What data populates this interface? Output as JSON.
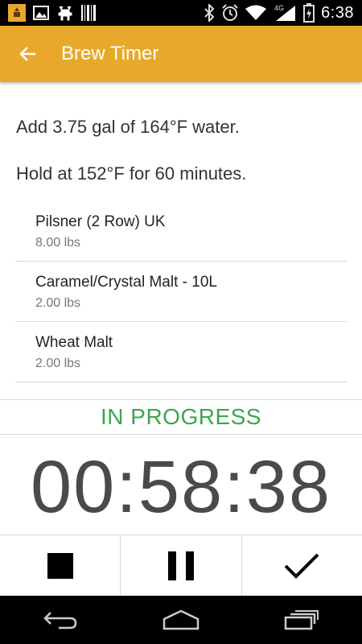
{
  "status_bar": {
    "time": "6:38",
    "network": "4G",
    "icons": [
      "brewery-icon",
      "image-icon",
      "deer-icon",
      "barcode-icon",
      "bluetooth-icon",
      "alarm-icon",
      "wifi-icon",
      "signal-icon",
      "battery-icon"
    ]
  },
  "app_bar": {
    "title": "Brew Timer",
    "background": "#e8a92a"
  },
  "instructions": {
    "line1": "Add 3.75 gal of 164°F water.",
    "line2": "Hold at 152°F for 60 minutes."
  },
  "ingredients": [
    {
      "name": "Pilsner (2 Row) UK",
      "amount": "8.00 lbs"
    },
    {
      "name": "Caramel/Crystal Malt - 10L",
      "amount": "2.00 lbs"
    },
    {
      "name": "Wheat Malt",
      "amount": "2.00 lbs"
    }
  ],
  "timer": {
    "status": "IN PROGRESS",
    "status_color": "#3aa84a",
    "time_remaining": "00:58:38"
  },
  "controls": [
    "stop-icon",
    "pause-icon",
    "checkmark-icon"
  ],
  "nav_bar": [
    "back-icon",
    "home-icon",
    "recent-apps-icon"
  ]
}
